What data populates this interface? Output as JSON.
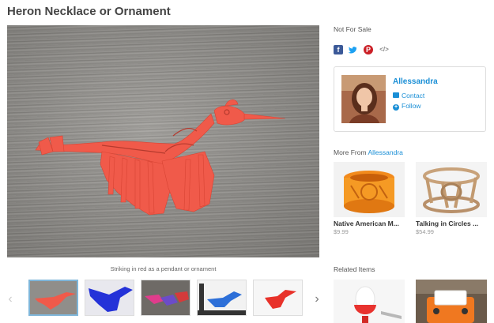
{
  "page": {
    "title": "Heron Necklace or Ornament"
  },
  "gallery": {
    "caption": "Striking in red as a pendant or ornament",
    "prev_arrow": "‹",
    "next_arrow": "›",
    "thumbnails": [
      {
        "label": "red heron",
        "active": true
      },
      {
        "label": "blue heron",
        "active": false
      },
      {
        "label": "multicolor herons",
        "active": false
      },
      {
        "label": "blue heron with ruler",
        "active": false
      },
      {
        "label": "red heron ornament",
        "active": false
      }
    ]
  },
  "sidebar": {
    "sale_status": "Not For Sale",
    "share": {
      "facebook": "f",
      "twitter": "🐦",
      "pinterest": "P",
      "embed": "</>"
    },
    "designer": {
      "name": "Allessandra",
      "contact_label": "Contact",
      "follow_label": "Follow"
    },
    "more_from": {
      "prefix": "More From",
      "name": "Allessandra",
      "items": [
        {
          "name": "Native American M...",
          "price": "$9.99"
        },
        {
          "name": "Talking in Circles ...",
          "price": "$54.99"
        }
      ]
    },
    "related_label": "Related Items"
  },
  "colors": {
    "accent": "#1a8fd6",
    "heron_red": "#f05a4a",
    "facebook": "#3b5998",
    "pinterest": "#cb2027"
  }
}
